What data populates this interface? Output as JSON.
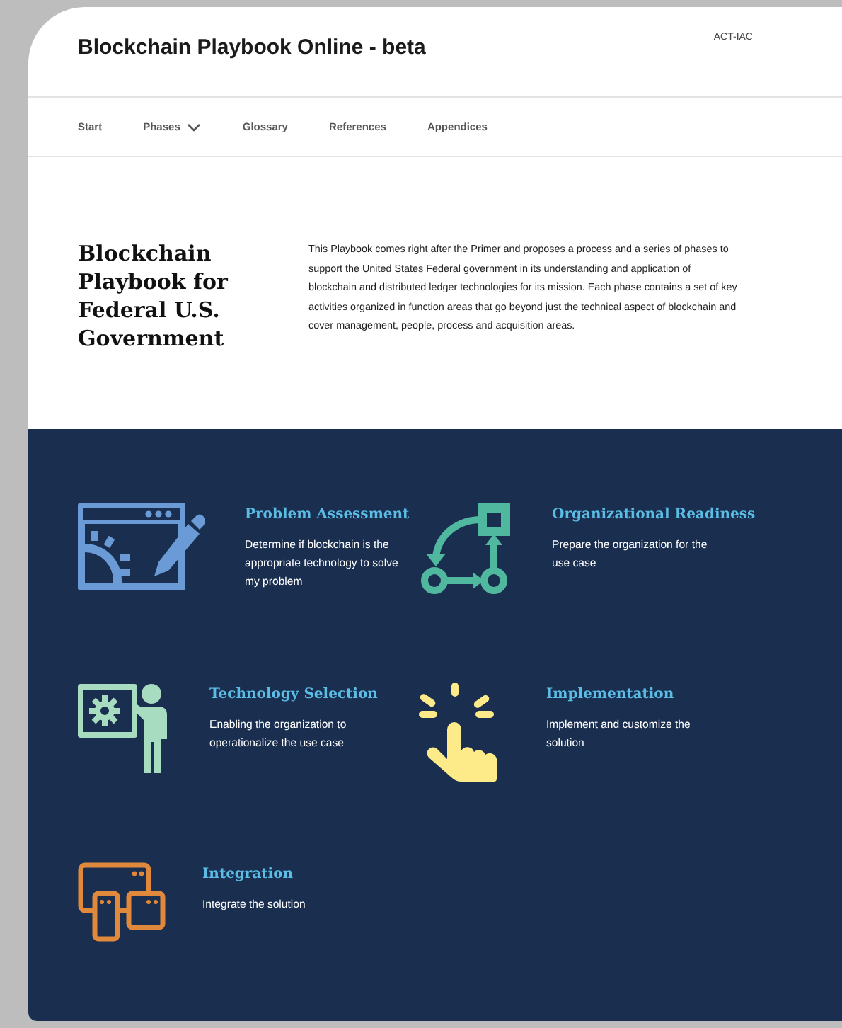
{
  "header": {
    "title": "Blockchain Playbook Online - beta",
    "org": "ACT-IAC"
  },
  "nav": [
    {
      "label": "Start",
      "kind": "link"
    },
    {
      "label": "Phases",
      "kind": "dropdown"
    },
    {
      "label": "Glossary",
      "kind": "link"
    },
    {
      "label": "References",
      "kind": "link"
    },
    {
      "label": "Appendices",
      "kind": "link"
    }
  ],
  "hero": {
    "heading": "Blockchain Playbook for Federal U.S. Government",
    "text": "This Playbook comes right after the Primer and proposes a process and a series of phases to support the United States Federal government in its understanding and application of blockchain and distributed ledger technologies for its mission. Each phase contains a set of key activities organized in function areas that go beyond just the technical aspect of blockchain and cover management, people, process and acquisition areas."
  },
  "phases": [
    {
      "kind": "assessment",
      "title": "Problem Assessment",
      "text": "Determine if blockchain is the appropriate technology to solve my problem"
    },
    {
      "kind": "readiness",
      "title": "Organizational Readiness",
      "text": "Prepare the organization for the use case"
    },
    {
      "kind": "selection",
      "title": "Technology Selection",
      "text": "Enabling the organization to operationalize the use case"
    },
    {
      "kind": "implementation",
      "title": "Implementation",
      "text": "Implement and customize the solution"
    },
    {
      "kind": "integration",
      "title": "Integration",
      "text": "Integrate the solution"
    }
  ]
}
